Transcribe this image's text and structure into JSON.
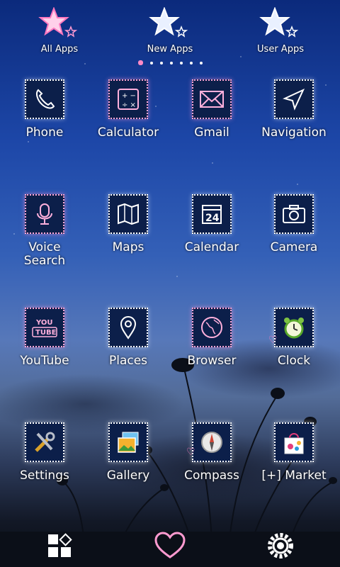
{
  "top_tabs": [
    {
      "id": "all-apps",
      "label": "All Apps"
    },
    {
      "id": "new-apps",
      "label": "New Apps"
    },
    {
      "id": "user-apps",
      "label": "User Apps"
    }
  ],
  "page_indicator": {
    "count": 7,
    "active": 0
  },
  "apps": [
    {
      "label": "Phone",
      "icon": "phone-icon"
    },
    {
      "label": "Calculator",
      "icon": "calculator-icon"
    },
    {
      "label": "Gmail",
      "icon": "gmail-icon"
    },
    {
      "label": "Navigation",
      "icon": "navigation-icon"
    },
    {
      "label": "Voice\nSearch",
      "icon": "microphone-icon"
    },
    {
      "label": "Maps",
      "icon": "map-icon"
    },
    {
      "label": "Calendar",
      "icon": "calendar-icon",
      "calendar_day": "24"
    },
    {
      "label": "Camera",
      "icon": "camera-icon"
    },
    {
      "label": "YouTube",
      "icon": "youtube-icon",
      "you": "YOU",
      "tube": "TUBE"
    },
    {
      "label": "Places",
      "icon": "location-pin-icon"
    },
    {
      "label": "Browser",
      "icon": "globe-icon"
    },
    {
      "label": "Clock",
      "icon": "alarm-clock-icon"
    },
    {
      "label": "Settings",
      "icon": "tools-icon"
    },
    {
      "label": "Gallery",
      "icon": "photos-icon"
    },
    {
      "label": "Compass",
      "icon": "compass-icon"
    },
    {
      "label": "[+] Market",
      "icon": "shopping-bag-icon"
    }
  ],
  "dock": [
    {
      "id": "apps",
      "icon": "app-drawer-icon"
    },
    {
      "id": "favorite",
      "icon": "heart-icon"
    },
    {
      "id": "settings",
      "icon": "gear-icon"
    }
  ],
  "colors": {
    "accent": "#ff8ac6",
    "icon_bg": "#0c1f4a",
    "text": "#ffffff"
  }
}
